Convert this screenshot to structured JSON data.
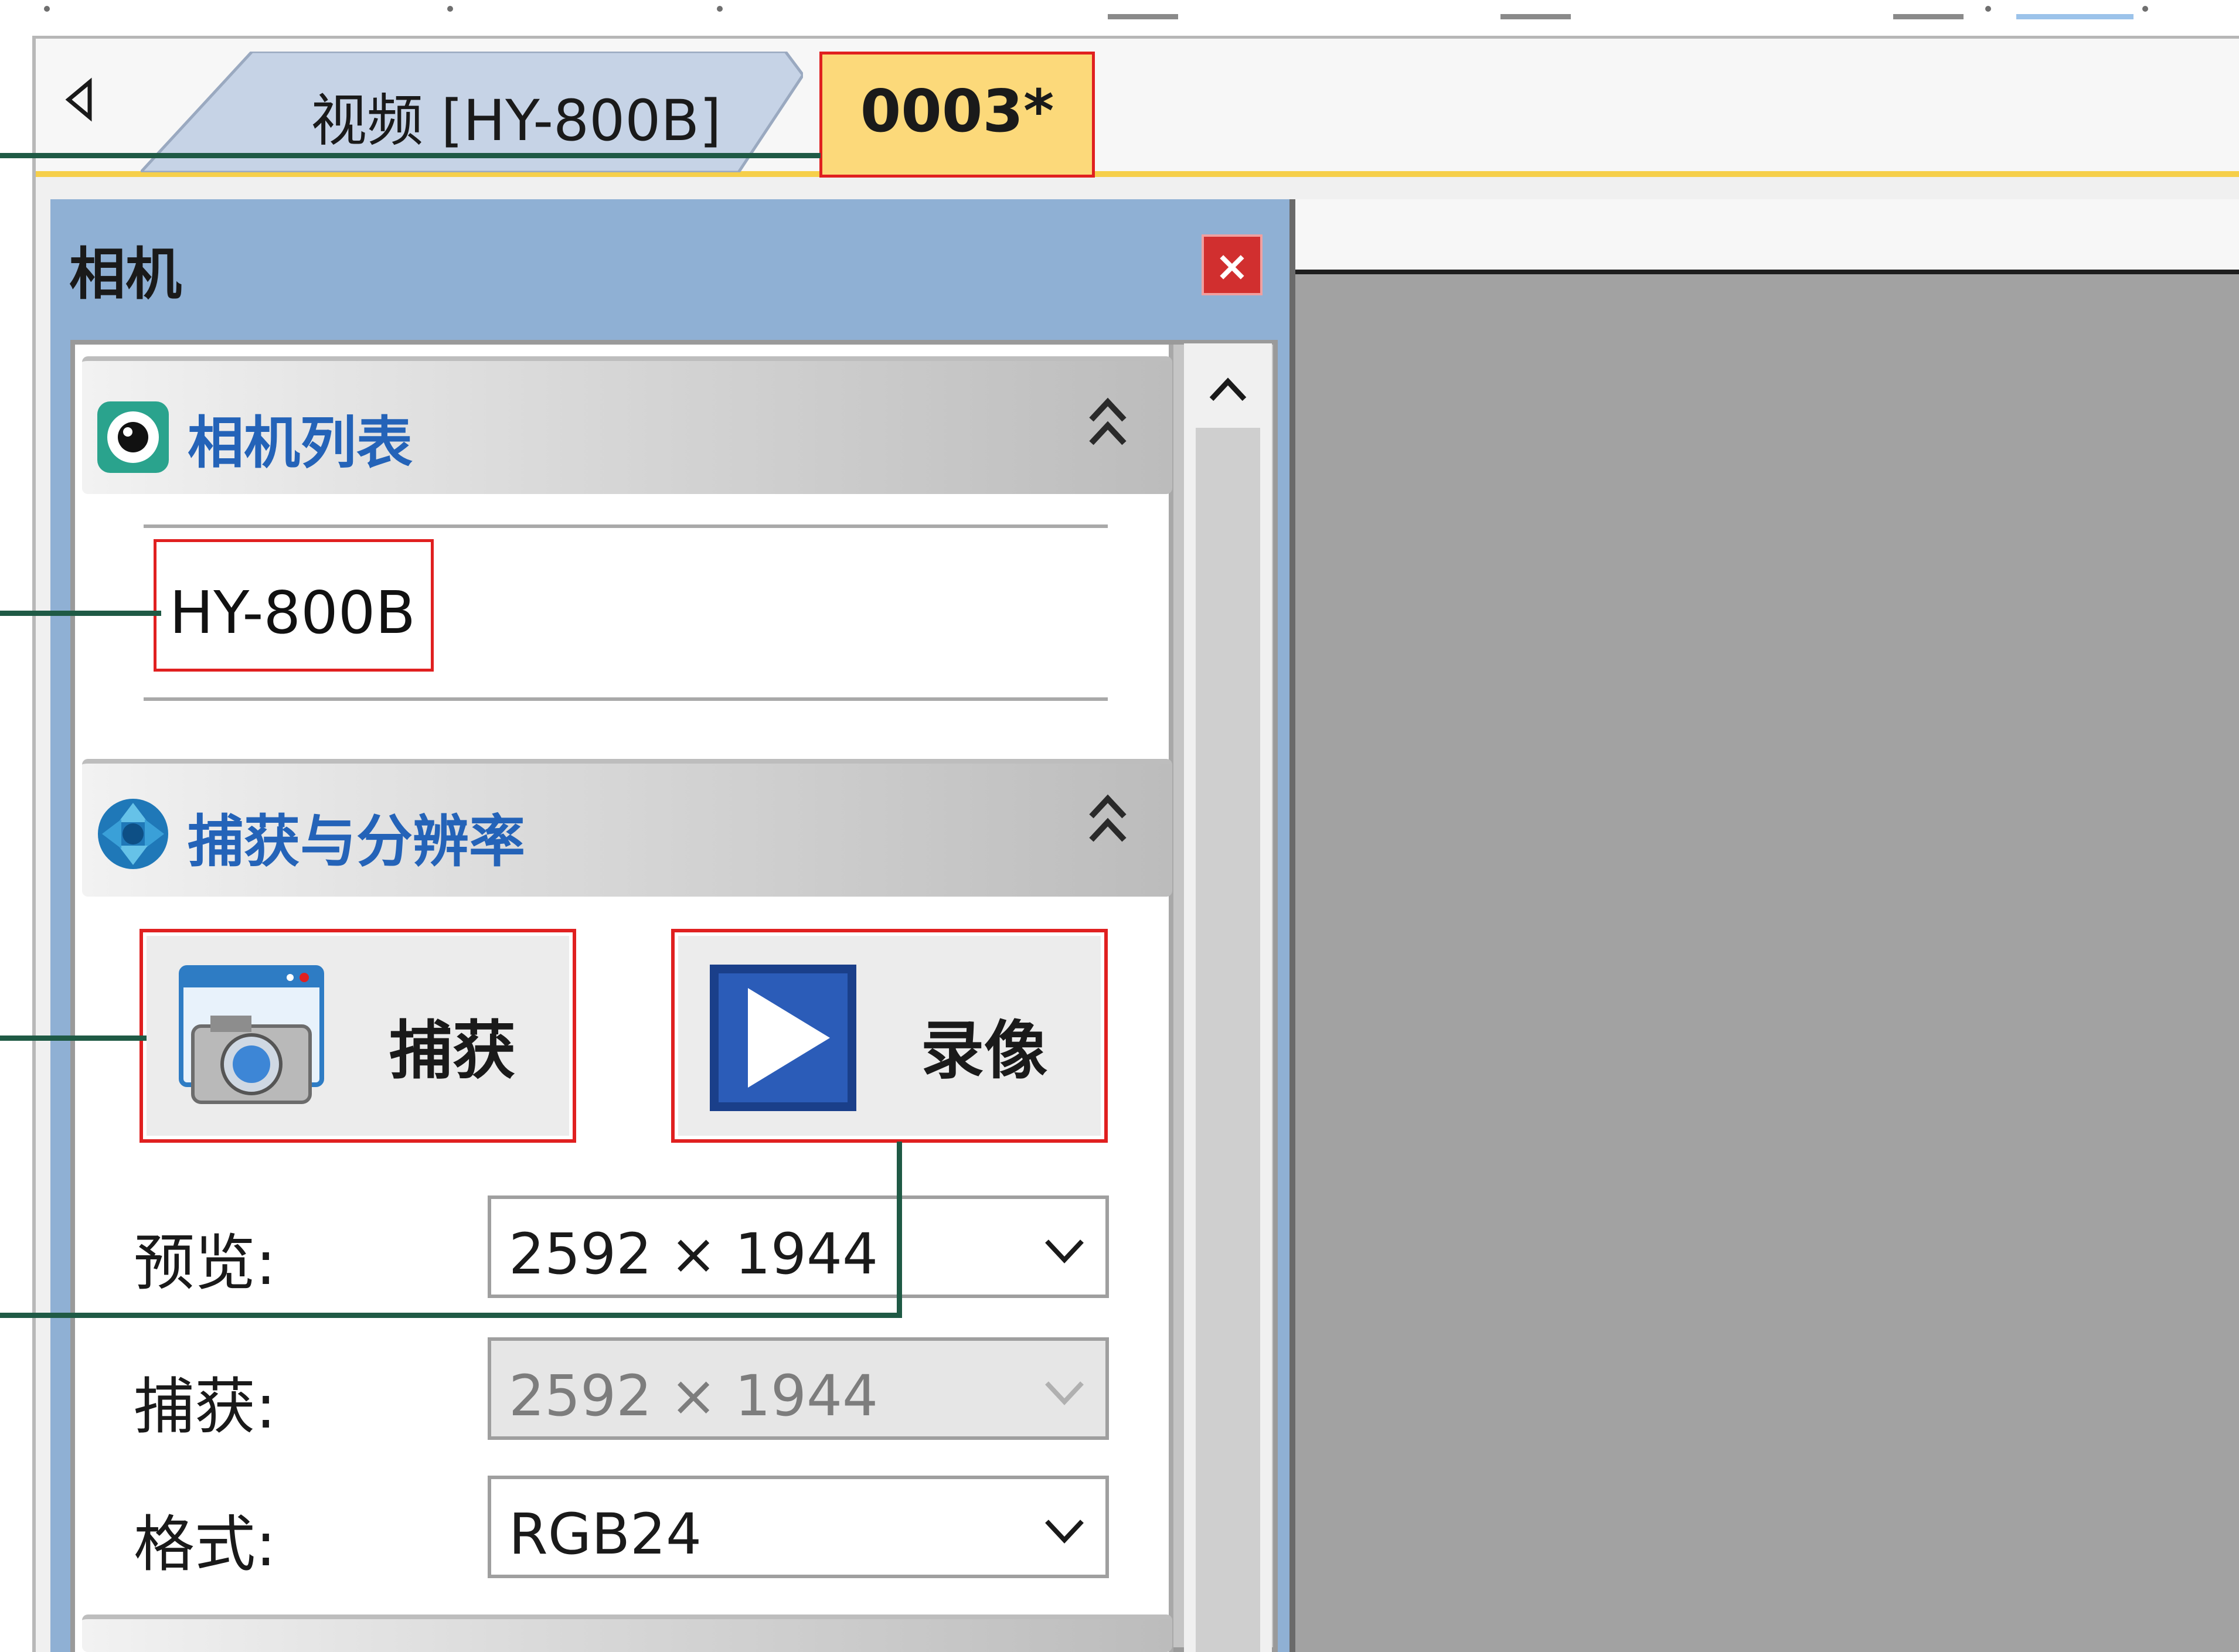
{
  "tabs": [
    {
      "label": "视频 [HY-800B]",
      "active": false
    },
    {
      "label": "0003*",
      "active": true
    }
  ],
  "pane": {
    "title": "相机",
    "close_glyph": "×"
  },
  "camera_list": {
    "title": "相机列表",
    "items": [
      "HY-800B"
    ]
  },
  "capture_section": {
    "title": "捕获与分辨率",
    "capture_button": "捕获",
    "record_button": "录像",
    "fields": [
      {
        "label": "预览:",
        "value": "2592 × 1944",
        "enabled": true
      },
      {
        "label": "捕获:",
        "value": "2592 × 1944",
        "enabled": false
      },
      {
        "label": "格式:",
        "value": "RGB24",
        "enabled": true
      }
    ]
  },
  "icons": {
    "scroll_left": "triangle-left-icon",
    "collapse": "double-chevron-up-icon",
    "scroll_up": "chevron-up-icon",
    "dropdown": "chevron-down-icon"
  },
  "colors": {
    "active_tab": "#fcd97a",
    "pane_header": "#8fb0d4",
    "section_title": "#2463b8",
    "highlight_box": "#e02020",
    "callout_line": "#1f5a45",
    "close_button": "#d12f2f"
  }
}
